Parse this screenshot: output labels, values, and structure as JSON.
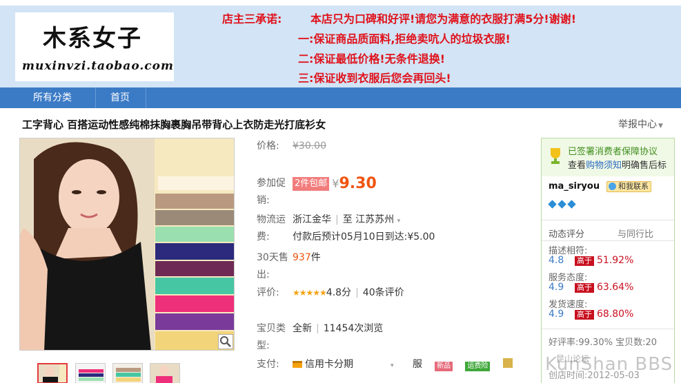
{
  "banner": {
    "shop_name": "木系女子",
    "shop_url": "muxinvzi.taobao.com",
    "promise_title": "店主三承诺:",
    "promise_main": "本店只为口碑和好评!请您为满意的衣服打满5分!谢谢!",
    "promise_1": "一:保证商品质面料,拒绝卖吭人的垃圾衣服!",
    "promise_2": "二:保证最低价格!无条件退换!",
    "promise_3": "三:保证收到衣服后您会再回头!"
  },
  "nav": {
    "all_categories": "所有分类",
    "home": "首页"
  },
  "product": {
    "title": "工字背心 百搭运动性感纯棉抹胸裹胸吊带背心上衣防走光打底衫女",
    "report": "举报中心",
    "price_label": "价格:",
    "original_price": "¥30.00",
    "promo_label": "参加促销:",
    "promo_tag": "2件包邮",
    "currency": "¥",
    "promo_price": "9.30",
    "shipping_label": "物流运费:",
    "ship_from": "浙江金华",
    "ship_to_prefix": "至",
    "ship_to": "江苏苏州",
    "delivery": "付款后预计05月10日到达:¥5.00",
    "sales_label": "30天售出:",
    "sales_count": "937",
    "sales_unit": "件",
    "rating_label": "评价:",
    "rating_stars": "★★★★★",
    "rating_score": "4.8分",
    "review_count": "40条评价",
    "type_label": "宝贝类型:",
    "condition": "全新",
    "views": "11454次浏览",
    "pay_label": "支付:",
    "payment": "信用卡分期",
    "service_label": "服",
    "badge_new": "新品",
    "badge_freight": "运费险"
  },
  "seller": {
    "signed": "已签署消费者保障协议",
    "check_prefix": "查看",
    "check_link": "购物须知",
    "check_suffix": "明确售后标",
    "name": "ma_siryou",
    "contact": "和我联系",
    "dynamic_rating": "动态评分",
    "peer_compare": "与同行比",
    "desc_label": "描述相符:",
    "desc_score": "4.8",
    "desc_badge": "高于",
    "desc_pct": "51.92%",
    "service_label": "服务态度:",
    "service_score": "4.9",
    "service_badge": "高于",
    "service_pct": "63.64%",
    "ship_label": "发货速度:",
    "ship_score": "4.9",
    "ship_badge": "高于",
    "ship_pct": "68.80%",
    "good_rate": "好评率:99.30% 宝贝数:20",
    "created": "创店时间:2012-05-03"
  },
  "watermark": {
    "text": "KunShan BBS",
    "small": "昆山论坛"
  },
  "colors": {
    "accent_red": "#e0121c",
    "nav_blue": "#3b7bc6",
    "price_orange": "#f0530f",
    "banner_bg": "#d2e4f5"
  }
}
